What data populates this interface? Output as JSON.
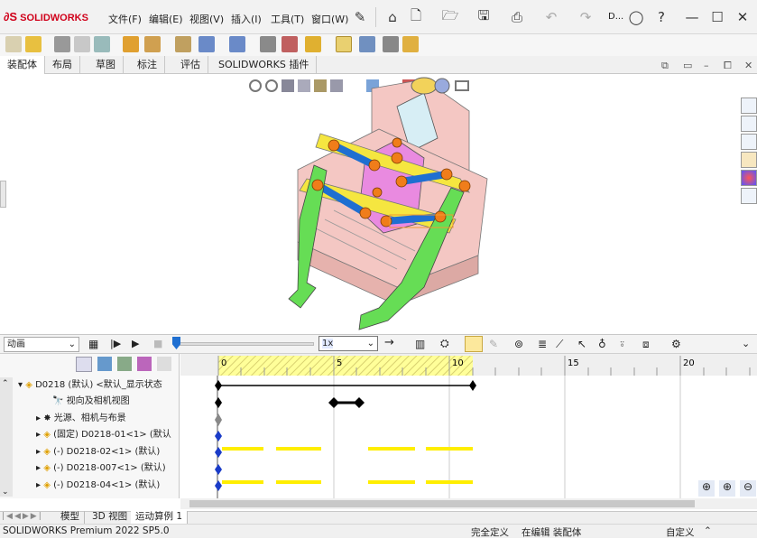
{
  "app": {
    "logo": "SOLIDWORKS",
    "doc_short": "D..."
  },
  "menu": [
    "文件(F)",
    "编辑(E)",
    "视图(V)",
    "插入(I)",
    "工具(T)",
    "窗口(W)"
  ],
  "tabs": [
    "装配体",
    "布局",
    "草图",
    "标注",
    "评估",
    "SOLIDWORKS 插件"
  ],
  "motion": {
    "study_type": "动画",
    "playback_speed": "1x",
    "ruler_labels": [
      "0",
      "5",
      "10",
      "15",
      "20"
    ],
    "timeline_fill": "#ffff66",
    "key_color": "#ffee00"
  },
  "tree": {
    "items": [
      "D0218 (默认) <默认_显示状态",
      "视向及相机视图",
      "光源、相机与布景",
      "(固定) D0218-01<1> (默认",
      "(-) D0218-02<1> (默认)",
      "(-) D0218-007<1> (默认)",
      "(-) D0218-04<1> (默认)"
    ]
  },
  "bottom_tabs": [
    "模型",
    "3D 视图",
    "运动算例 1"
  ],
  "status": {
    "product": "SOLIDWORKS Premium 2022 SP5.0",
    "state": "完全定义",
    "mode": "在编辑 装配体",
    "custom": "自定义"
  },
  "colors": {
    "accent": "#d0021b",
    "part_pink": "#f4c7c3",
    "part_green": "#66dd55",
    "part_yellow": "#f5e640",
    "part_blue": "#1f6fd1",
    "part_orange": "#f07d1a"
  }
}
